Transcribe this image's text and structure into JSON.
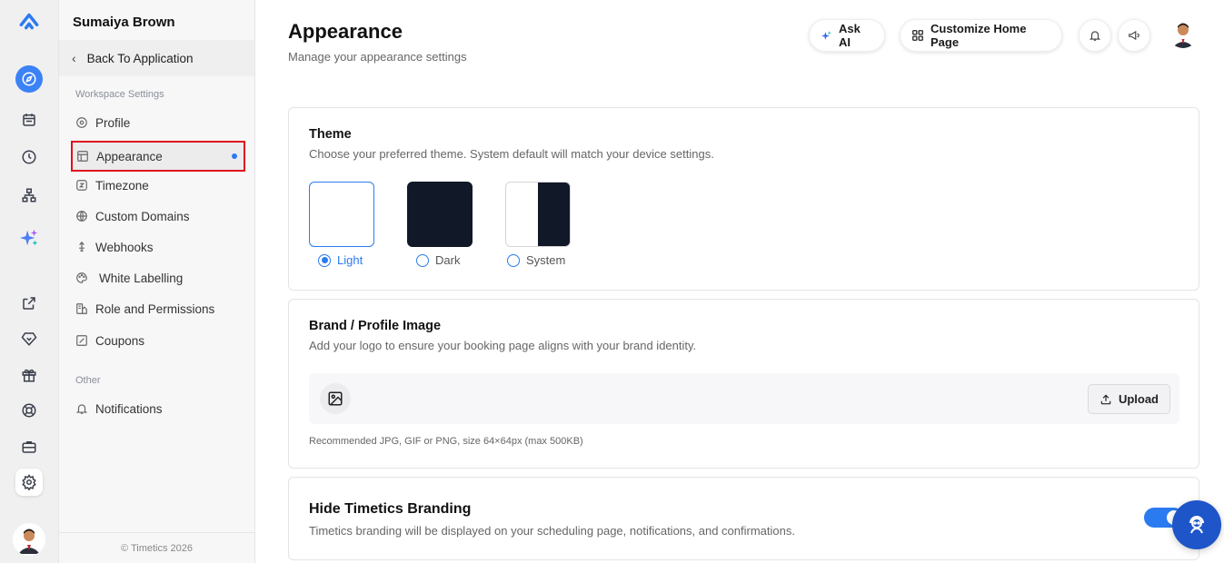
{
  "rail": {
    "icons": [
      "logo-icon",
      "compass-icon",
      "calendar-icon",
      "clock-icon",
      "sitemap-icon",
      "sparkles-icon",
      "external-link-icon",
      "gem-icon",
      "gift-icon",
      "lifebuoy-icon",
      "briefcase-icon",
      "gear-icon"
    ],
    "brand_color": "#3b82f6"
  },
  "sidebar": {
    "user_name": "Sumaiya Brown",
    "back_label": "Back To Application",
    "section_workspace": "Workspace Settings",
    "items": [
      {
        "label": "Profile",
        "icon": "gear-icon"
      },
      {
        "label": "Appearance",
        "icon": "layout-icon",
        "active": true
      },
      {
        "label": "Timezone",
        "icon": "timezone-icon"
      },
      {
        "label": "Custom Domains",
        "icon": "globe-icon"
      },
      {
        "label": "Webhooks",
        "icon": "webhook-icon"
      },
      {
        "label": "White Labelling",
        "icon": "palette-icon"
      },
      {
        "label": "Role and Permissions",
        "icon": "role-icon"
      },
      {
        "label": "Coupons",
        "icon": "coupon-icon"
      }
    ],
    "section_other": "Other",
    "other_items": [
      {
        "label": "Notifications",
        "icon": "bell-icon"
      }
    ],
    "footer": "© Timetics 2026"
  },
  "header": {
    "title": "Appearance",
    "subtitle": "Manage your appearance settings",
    "ask_ai_label": "Ask AI",
    "customize_label": "Customize Home Page"
  },
  "theme": {
    "title": "Theme",
    "description": "Choose your preferred theme. System default will match your device settings.",
    "options": [
      {
        "label": "Light",
        "selected": true
      },
      {
        "label": "Dark",
        "selected": false
      },
      {
        "label": "System",
        "selected": false
      }
    ]
  },
  "brand": {
    "title": "Brand / Profile Image",
    "description": "Add your logo to ensure your booking page aligns with your brand identity.",
    "upload_label": "Upload",
    "note": "Recommended JPG, GIF or PNG, size 64×64px (max 500KB)"
  },
  "branding": {
    "title": "Hide Timetics Branding",
    "description": "Timetics branding will be displayed on your scheduling page, notifications, and confirmations.",
    "enabled": true
  },
  "accent_color": "#2b7bf0"
}
